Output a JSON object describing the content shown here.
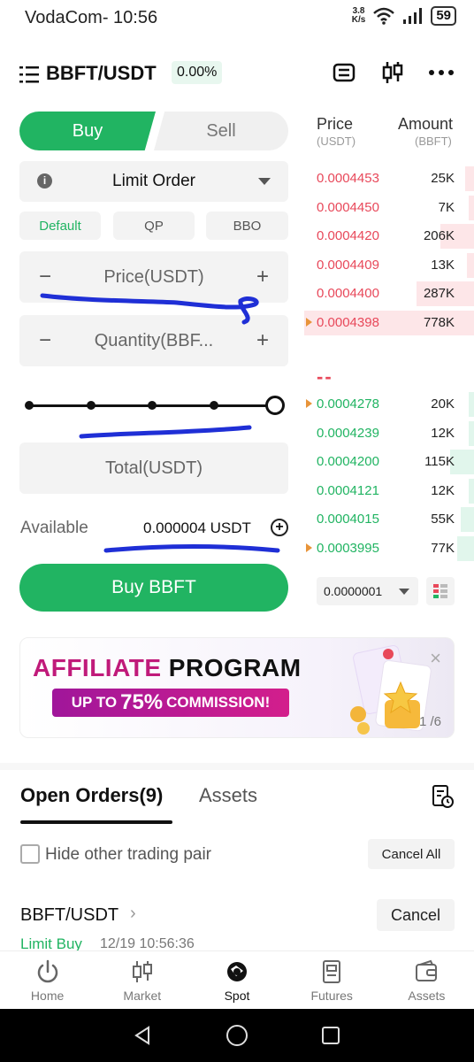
{
  "status_bar": {
    "carrier_time": "VodaCom- 10:56",
    "net_speed_value": "3.8",
    "net_speed_unit": "K/s",
    "battery": "59"
  },
  "header": {
    "pair": "BBFT/USDT",
    "change": "0.00%"
  },
  "trade_form": {
    "buy_tab": "Buy",
    "sell_tab": "Sell",
    "order_type": "Limit Order",
    "modes": [
      "Default",
      "QP",
      "BBO"
    ],
    "price_placeholder": "Price(USDT)",
    "quantity_placeholder": "Quantity(BBF...",
    "stepper_minus": "−",
    "stepper_plus": "+",
    "total_placeholder": "Total(USDT)",
    "available_label": "Available",
    "available_value": "0.000004 USDT",
    "submit_label": "Buy BBFT",
    "slider_percent": 100
  },
  "order_book": {
    "price_header": "Price",
    "price_unit": "(USDT)",
    "amount_header": "Amount",
    "amount_unit": "(BBFT)",
    "asks": [
      {
        "price": "0.0004453",
        "amount": "25K",
        "depth": 0.05
      },
      {
        "price": "0.0004450",
        "amount": "7K",
        "depth": 0.03
      },
      {
        "price": "0.0004420",
        "amount": "206K",
        "depth": 0.2
      },
      {
        "price": "0.0004409",
        "amount": "13K",
        "depth": 0.04
      },
      {
        "price": "0.0004400",
        "amount": "287K",
        "depth": 0.34
      },
      {
        "price": "0.0004398",
        "amount": "778K",
        "depth": 1.0
      }
    ],
    "mid_price": "--",
    "bids": [
      {
        "price": "0.0004278",
        "amount": "20K",
        "depth": 0.03
      },
      {
        "price": "0.0004239",
        "amount": "12K",
        "depth": 0.03
      },
      {
        "price": "0.0004200",
        "amount": "115K",
        "depth": 0.14
      },
      {
        "price": "0.0004121",
        "amount": "12K",
        "depth": 0.03
      },
      {
        "price": "0.0004015",
        "amount": "55K",
        "depth": 0.08
      },
      {
        "price": "0.0003995",
        "amount": "77K",
        "depth": 0.1
      }
    ],
    "tick_size": "0.0000001"
  },
  "banner": {
    "title_accent": "AFFILIATE",
    "title_rest": " PROGRAM",
    "pill_prefix": "UP TO ",
    "pill_big": "75%",
    "pill_suffix": " COMMISSION!",
    "close": "×",
    "page": "1 /6"
  },
  "orders": {
    "tab_open": "Open Orders(9)",
    "tab_assets": "Assets",
    "hide_pairs_label": "Hide other trading pair",
    "cancel_all": "Cancel All",
    "item": {
      "pair": "BBFT/USDT",
      "chevron": "›",
      "type": "Limit Buy",
      "time": "12/19 10:56:36",
      "cancel": "Cancel"
    }
  },
  "bottom_nav": {
    "items": [
      {
        "label": "Home",
        "icon": "power-icon"
      },
      {
        "label": "Market",
        "icon": "candlestick-icon"
      },
      {
        "label": "Spot",
        "icon": "spot-icon",
        "active": true
      },
      {
        "label": "Futures",
        "icon": "futures-icon"
      },
      {
        "label": "Assets",
        "icon": "wallet-icon"
      }
    ]
  },
  "colors": {
    "buy_green": "#21b462",
    "sell_red": "#e8485a",
    "accent_magenta": "#c01a7a"
  }
}
